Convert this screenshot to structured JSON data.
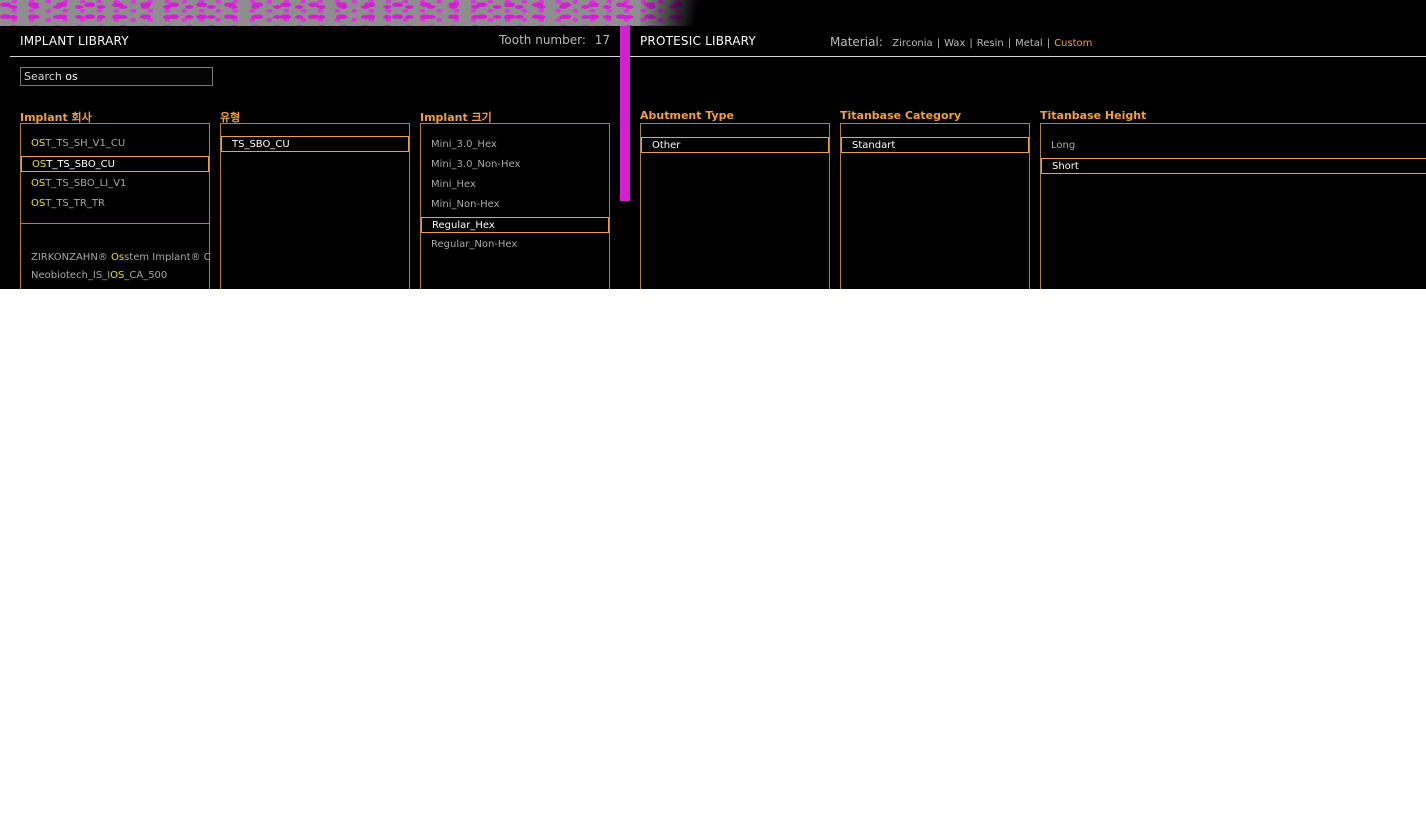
{
  "implant_library": {
    "title": "IMPLANT LIBRARY",
    "tooth_number_label": "Tooth number:",
    "tooth_number_value": "17",
    "search": {
      "placeholder": "Search",
      "value": "os"
    },
    "columns": {
      "company": {
        "title": "Implant 회사",
        "items": [
          {
            "hl": "OS",
            "rest": "T_TS_SH_V1_CU",
            "selected": false
          },
          {
            "hl": "OS",
            "rest": "T_TS_SBO_CU",
            "selected": true
          },
          {
            "hl": "OS",
            "rest": "T_TS_SBO_LI_V1",
            "selected": false
          },
          {
            "hl": "OS",
            "rest": "T_TS_TR_TR",
            "selected": false
          }
        ],
        "other_items": [
          {
            "pre": "ZIRKONZAHN® ",
            "hl": "Os",
            "rest": "stem Implant® C"
          },
          {
            "pre": "Neobiotech_IS_I",
            "hl": "OS",
            "rest": "_CA_500"
          }
        ]
      },
      "type": {
        "title": "유형",
        "items": [
          {
            "label": "TS_SBO_CU",
            "selected": true
          }
        ]
      },
      "size": {
        "title": "Implant 크기",
        "items": [
          {
            "label": "Mini_3.0_Hex",
            "selected": false
          },
          {
            "label": "Mini_3.0_Non-Hex",
            "selected": false
          },
          {
            "label": "Mini_Hex",
            "selected": false
          },
          {
            "label": "Mini_Non-Hex",
            "selected": false
          },
          {
            "label": "Regular_Hex",
            "selected": true
          },
          {
            "label": "Regular_Non-Hex",
            "selected": false
          }
        ]
      }
    }
  },
  "protesic_library": {
    "title": "PROTESIC LIBRARY",
    "material_label": "Material:",
    "materials": [
      {
        "label": "Zirconia",
        "active": false
      },
      {
        "label": "Wax",
        "active": false
      },
      {
        "label": "Resin",
        "active": false
      },
      {
        "label": "Metal",
        "active": false
      },
      {
        "label": "Custom",
        "active": true
      }
    ],
    "columns": {
      "abutment_type": {
        "title": "Abutment Type",
        "items": [
          {
            "label": "Other",
            "selected": true
          }
        ]
      },
      "titanbase_category": {
        "title": "Titanbase Category",
        "items": [
          {
            "label": "Standart",
            "selected": true
          }
        ]
      },
      "titanbase_height": {
        "title": "Titanbase Height",
        "items": [
          {
            "label": "Long",
            "selected": false
          },
          {
            "label": "Short",
            "selected": true
          }
        ]
      }
    }
  },
  "colors": {
    "accent": "#f0a040",
    "highlight": "#e8e030",
    "magenta": "#d41fd4"
  }
}
